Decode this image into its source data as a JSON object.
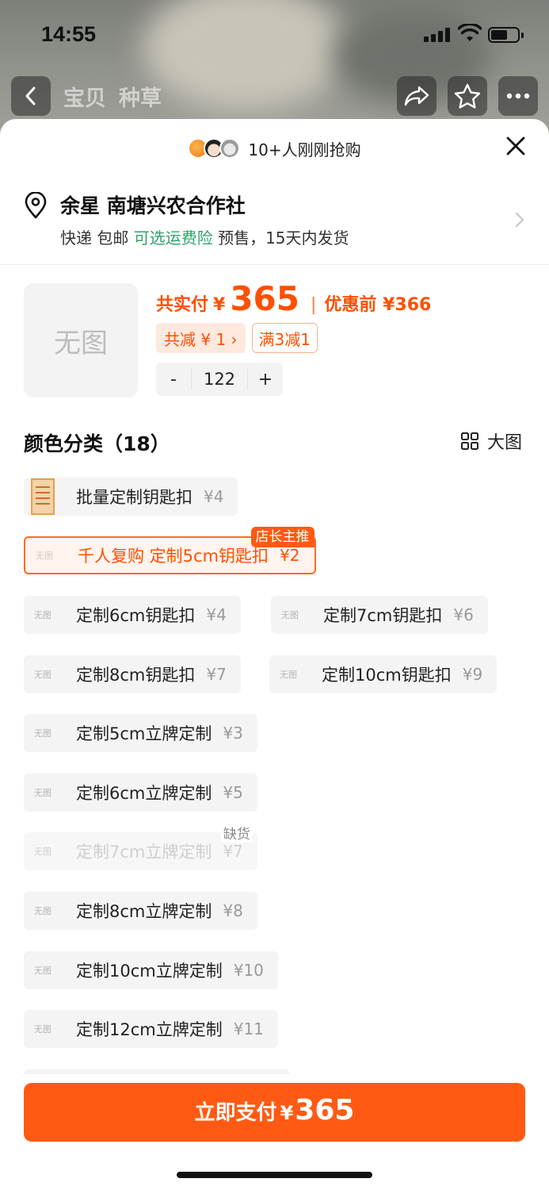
{
  "status_bar": {
    "time": "14:55"
  },
  "nav": {
    "tab_product": "宝贝",
    "tab_grass": "种草"
  },
  "header": {
    "buyers_text": "10+人刚刚抢购"
  },
  "address": {
    "name": "余星 南塘兴农合作社",
    "ship_part1": "快递 包邮 ",
    "ship_insurance": "可选运费险",
    "ship_part2": " 预售，15天内发货"
  },
  "product": {
    "no_image": "无图",
    "pay_label": "共实付",
    "currency": "¥",
    "pay_amount": "365",
    "sep": "|",
    "orig_label": "优惠前 ¥366",
    "discount_total": "共减 ¥ 1 ›",
    "discount_rule": "满3减1",
    "quantity": "122",
    "minus": "-",
    "plus": "+"
  },
  "section": {
    "title": "颜色分类（18）",
    "big_view": "大图"
  },
  "options": [
    {
      "name": "批量定制钥匙扣",
      "price": "¥4"
    },
    {
      "name": "千人复购  定制5cm钥匙扣",
      "price": "¥2",
      "badge": "店长主推"
    },
    {
      "name": "定制6cm钥匙扣",
      "price": "¥4"
    },
    {
      "name": "定制7cm钥匙扣",
      "price": "¥6"
    },
    {
      "name": "定制8cm钥匙扣",
      "price": "¥7"
    },
    {
      "name": "定制10cm钥匙扣",
      "price": "¥9"
    },
    {
      "name": "定制5cm立牌定制",
      "price": "¥3"
    },
    {
      "name": "定制6cm立牌定制",
      "price": "¥5"
    },
    {
      "name": "定制7cm立牌定制",
      "price": "¥7",
      "badge": "缺货"
    },
    {
      "name": "定制8cm立牌定制",
      "price": "¥8"
    },
    {
      "name": "定制10cm立牌定制",
      "price": "¥10"
    },
    {
      "name": "定制12cm立牌定制",
      "price": "¥11"
    }
  ],
  "option_no_image": "无图",
  "footer": {
    "pay_label": "立即支付",
    "currency": "¥",
    "amount": "365"
  },
  "colors": {
    "accent": "#ff5000",
    "button": "#ff5a14",
    "green": "#2fa36a"
  }
}
